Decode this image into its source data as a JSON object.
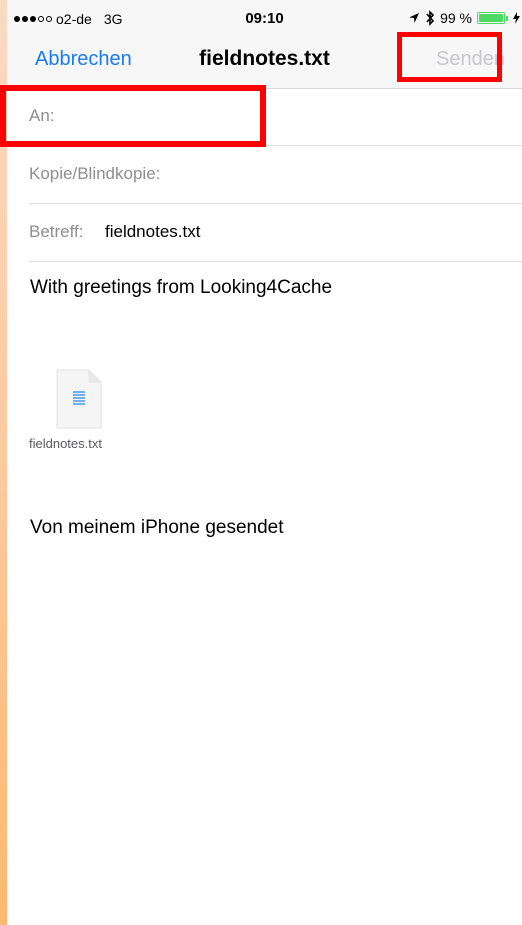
{
  "status_bar": {
    "carrier": "o2-de",
    "network": "3G",
    "time": "09:10",
    "battery_text": "99 %",
    "battery_level": 0.99,
    "signal_bars_filled": 3,
    "signal_bars_total": 5,
    "icons": [
      "location-arrow-icon",
      "bluetooth-icon",
      "battery-icon",
      "charging-bolt-icon"
    ],
    "battery_color": "#4cd964"
  },
  "nav": {
    "cancel_label": "Abbrechen",
    "title": "fieldnotes.txt",
    "send_label": "Senden",
    "accent_color": "#1a7cf5",
    "disabled_color": "#c8c8cc"
  },
  "fields": {
    "to_label": "An:",
    "to_value": "",
    "cc_label": "Kopie/Blindkopie:",
    "subject_label": "Betreff:",
    "subject_value": "fieldnotes.txt"
  },
  "message": {
    "greeting": "With greetings from Looking4Cache",
    "attachment_name": "fieldnotes.txt",
    "attachment_icon": "text-document-icon",
    "signature": "Von meinem iPhone gesendet"
  },
  "highlights": {
    "color": "#ff0000",
    "targets": [
      "send-button",
      "to-field"
    ]
  }
}
